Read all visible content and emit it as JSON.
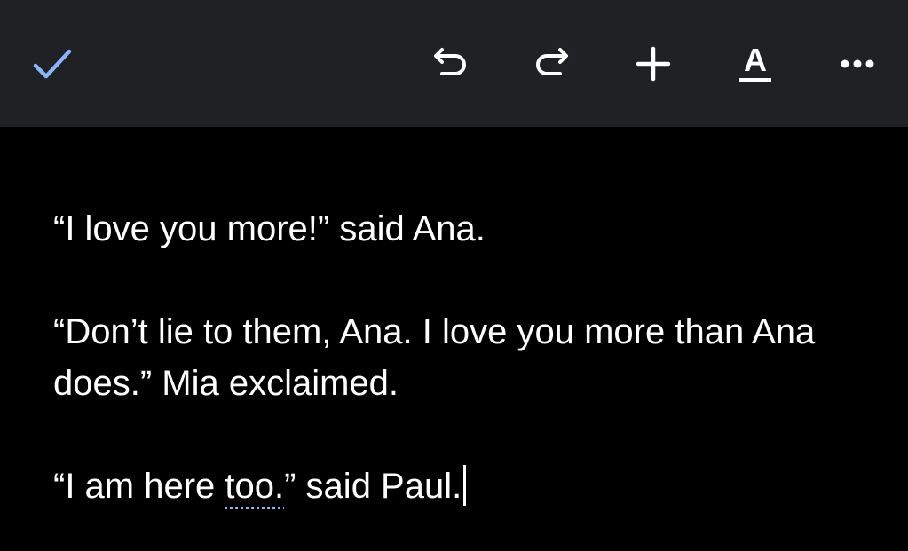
{
  "toolbar": {
    "icons": {
      "done": "checkmark-icon",
      "undo": "undo-icon",
      "redo": "redo-icon",
      "insert": "plus-icon",
      "format": "text-format-icon",
      "more": "more-horizontal-icon"
    },
    "format_glyph": "A"
  },
  "document": {
    "paragraphs": [
      {
        "text": "“I love you more!” said Ana."
      },
      {
        "text": "“Don’t lie to them, Ana. I love you more than Ana does.” Mia exclaimed."
      },
      {
        "before": "“I am here ",
        "flagged": "too.",
        "after": "” said Paul."
      }
    ]
  },
  "colors": {
    "toolbar_bg": "#202124",
    "page_bg": "#000000",
    "accent": "#8ab4f8",
    "text": "#ffffff"
  }
}
